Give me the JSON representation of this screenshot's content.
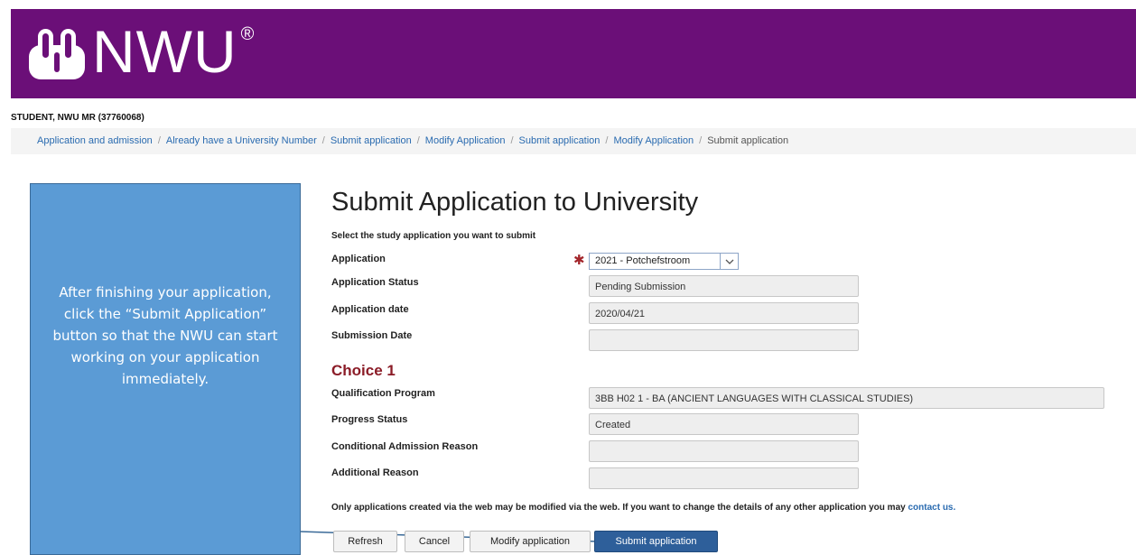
{
  "header": {
    "logo_text": "NWU",
    "logo_reg": "®"
  },
  "user": {
    "name_line": "STUDENT, NWU MR (37760068)"
  },
  "breadcrumb": {
    "items": [
      "Application and admission",
      "Already have a University Number",
      "Submit application",
      "Modify Application",
      "Submit application",
      "Modify Application",
      "Submit application"
    ],
    "separator": "/"
  },
  "callout": {
    "text": "After finishing your application, click the “Submit Application” button so that the NWU can start working on your application immediately."
  },
  "page": {
    "title": "Submit Application to University",
    "intro": "Select the study application you want to submit"
  },
  "application": {
    "application_label": "Application",
    "application_value": "2021 - Potchefstroom",
    "required_mark": "✱",
    "status_label": "Application Status",
    "status_value": "Pending Submission",
    "date_label": "Application date",
    "date_value": "2020/04/21",
    "submission_label": "Submission Date",
    "submission_value": ""
  },
  "choice": {
    "title": "Choice 1",
    "qualification_label": "Qualification Program",
    "qualification_value": "3BB H02 1 - BA (ANCIENT LANGUAGES WITH CLASSICAL STUDIES)",
    "progress_label": "Progress Status",
    "progress_value": "Created",
    "conditional_label": "Conditional Admission Reason",
    "conditional_value": "",
    "additional_label": "Additional Reason",
    "additional_value": ""
  },
  "note": {
    "text": "Only applications created via the web may be modified via the web. If you want to change the details of any other application you may ",
    "link": "contact us."
  },
  "buttons": {
    "refresh": "Refresh",
    "cancel": "Cancel",
    "modify": "Modify application",
    "submit": "Submit application"
  },
  "colors": {
    "brand_purple": "#6b0f78",
    "callout_blue": "#5b9bd5",
    "link_blue": "#2a6bb0",
    "choice_red": "#8b1c27",
    "primary_button": "#2e5f9a"
  }
}
